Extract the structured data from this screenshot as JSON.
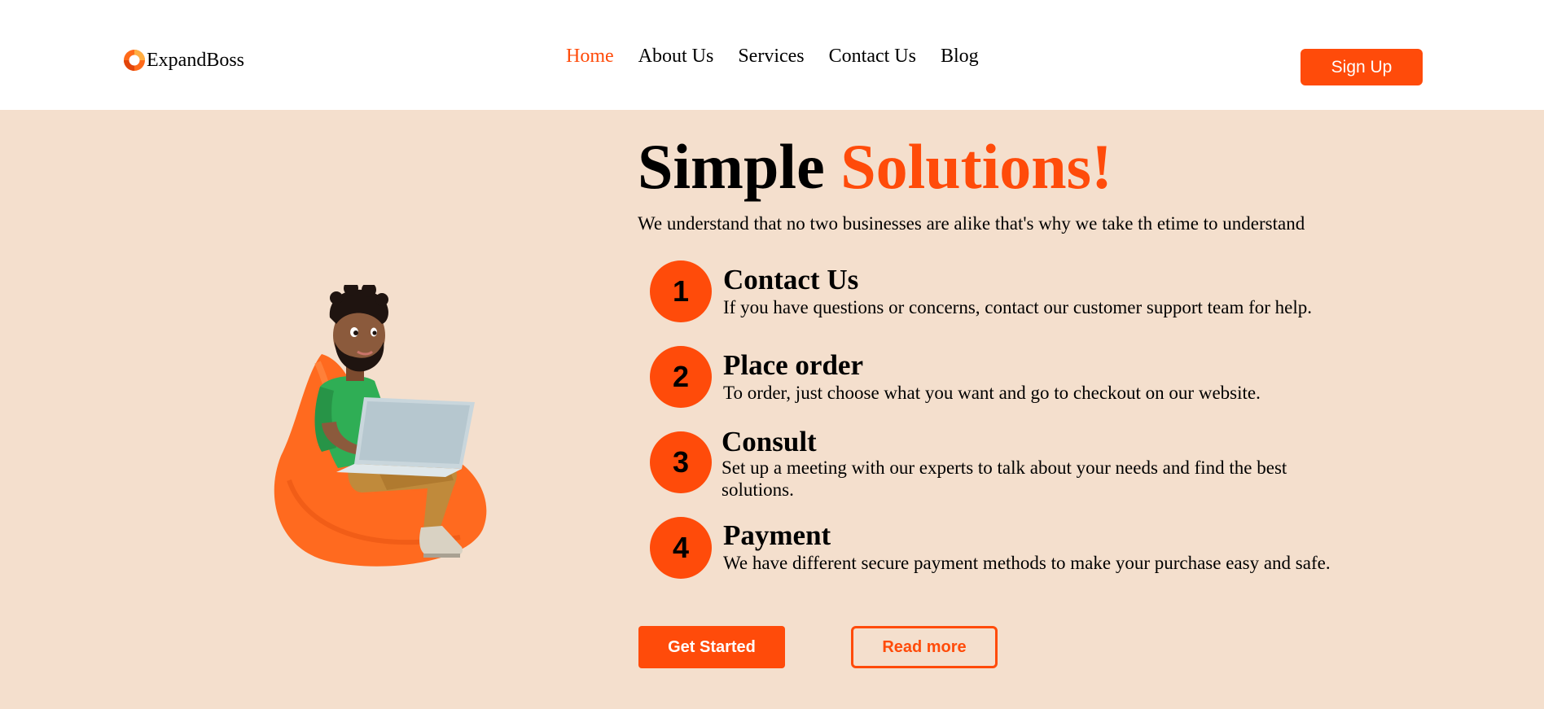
{
  "brand": {
    "name": "ExpandBoss",
    "logo_icon": "expandboss-logo-icon",
    "accent_color": "#ff4b0a",
    "background_color": "#f4dfcd"
  },
  "nav": {
    "items": [
      {
        "label": "Home",
        "active": true
      },
      {
        "label": "About Us",
        "active": false
      },
      {
        "label": "Services",
        "active": false
      },
      {
        "label": "Contact Us",
        "active": false
      },
      {
        "label": "Blog",
        "active": false
      }
    ]
  },
  "header": {
    "signup_label": "Sign Up"
  },
  "hero": {
    "title_part1": "Simple",
    "title_part2": "Solutions!",
    "subtitle": "We understand that no two businesses are alike that's why we take th etime to understand",
    "illustration": "man-on-beanbag-with-laptop-illustration"
  },
  "steps": [
    {
      "number": "1",
      "title": "Contact Us",
      "description": "If you have questions or concerns, contact our customer support team for help."
    },
    {
      "number": "2",
      "title": "Place order",
      "description": "To order, just choose what you want and go to checkout on our website."
    },
    {
      "number": "3",
      "title": "Consult",
      "description": "Set up a meeting with our experts to talk about your needs and find the best solutions."
    },
    {
      "number": "4",
      "title": "Payment",
      "description": "We have different secure payment methods to make your purchase easy and safe."
    }
  ],
  "cta": {
    "primary_label": "Get Started",
    "secondary_label": "Read more"
  }
}
